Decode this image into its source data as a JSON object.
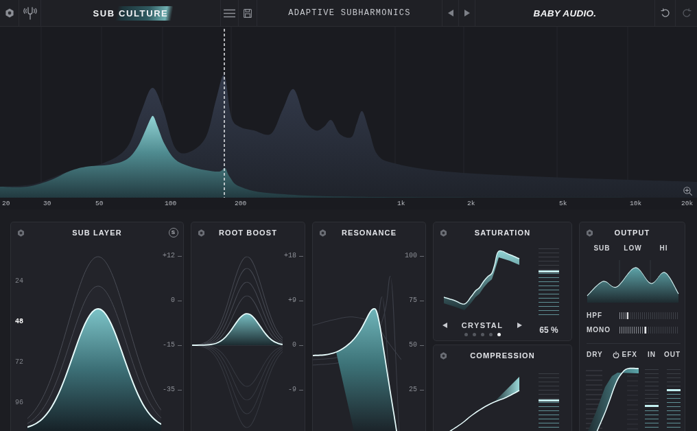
{
  "header": {
    "logo": "SUB CULTURE",
    "preset_name": "ADAPTIVE SUBHARMONICS",
    "brand": "BABY AUDIO."
  },
  "spectrum": {
    "frequency_labels": [
      "20",
      "30",
      "50",
      "100",
      "200",
      "1k",
      "2k",
      "5k",
      "10k",
      "20k"
    ]
  },
  "sub_layer": {
    "title": "SUB LAYER",
    "solo_button": "S",
    "note_labels": [
      {
        "label": "24",
        "selected": false
      },
      {
        "label": "48",
        "selected": true
      },
      {
        "label": "72",
        "selected": false
      },
      {
        "label": "96",
        "selected": false
      }
    ],
    "gain_labels": [
      "+12",
      "0",
      "-15",
      "-35"
    ]
  },
  "root_boost": {
    "title": "ROOT BOOST",
    "gain_labels": [
      "+18",
      "+9",
      "0",
      "-9"
    ]
  },
  "resonance": {
    "title": "RESONANCE",
    "scale_labels": [
      "100",
      "75",
      "50",
      "25"
    ]
  },
  "saturation": {
    "title": "SATURATION",
    "mode": "CRYSTAL",
    "mode_dots": [
      {
        "selected": false
      },
      {
        "selected": false
      },
      {
        "selected": false
      },
      {
        "selected": false
      },
      {
        "selected": true
      }
    ],
    "fader": {
      "level": 0.65
    },
    "reading": "65 %"
  },
  "compression": {
    "title": "COMPRESSION",
    "fader": {
      "level": 0.52
    }
  },
  "output": {
    "title": "OUTPUT",
    "band_labels": [
      "SUB",
      "LOW",
      "HI"
    ],
    "sliders": [
      {
        "label": "HPF",
        "level": 0.15
      },
      {
        "label": "MONO",
        "level": 0.45
      }
    ],
    "dry_label": "DRY",
    "efx_label": "EFX",
    "meters": [
      {
        "label": "IN",
        "level": 0.42
      },
      {
        "label": "OUT",
        "level": 0.67
      }
    ]
  }
}
